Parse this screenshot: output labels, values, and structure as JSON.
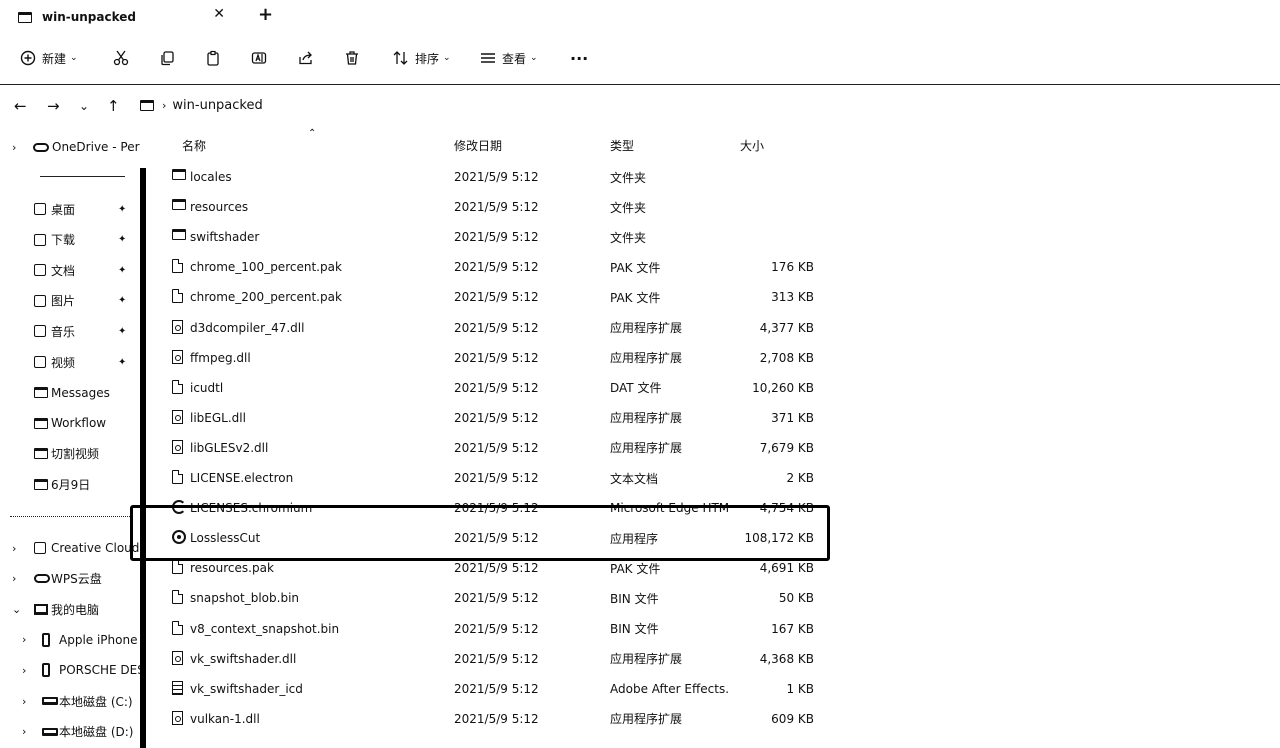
{
  "tab": {
    "title": "win-unpacked",
    "close": "✕",
    "new_tab": "+"
  },
  "toolbar": {
    "new_label": "新建",
    "new_chevron": "⌄",
    "sort_label": "排序",
    "view_label": "查看",
    "more": "···",
    "icons": [
      "plus-circle-icon",
      "cut-icon",
      "copy-icon",
      "paste-icon",
      "rename-icon",
      "share-icon",
      "delete-icon",
      "sort-icon",
      "view-icon"
    ]
  },
  "address": {
    "back": "←",
    "forward": "→",
    "recent": "⌄",
    "up": "↑",
    "separator": "›",
    "path": "win-unpacked"
  },
  "sidebar": {
    "onedrive": "OneDrive - Per",
    "quick_access": [
      {
        "label": "桌面",
        "pinned": true
      },
      {
        "label": "下载",
        "pinned": true
      },
      {
        "label": "文档",
        "pinned": true
      },
      {
        "label": "图片",
        "pinned": true
      },
      {
        "label": "音乐",
        "pinned": true
      },
      {
        "label": "视频",
        "pinned": true
      },
      {
        "label": "Messages",
        "pinned": false
      },
      {
        "label": "Workflow",
        "pinned": false
      },
      {
        "label": "切割视频",
        "pinned": false
      },
      {
        "label": "6月9日",
        "pinned": false
      }
    ],
    "locations": [
      {
        "label": "Creative Cloud",
        "expander": "›"
      },
      {
        "label": "WPS云盘",
        "expander": "›"
      },
      {
        "label": "我的电脑",
        "expander": "⌄"
      },
      {
        "label": "Apple iPhone",
        "expander": "›"
      },
      {
        "label": "PORSCHE DESIGN",
        "expander": "›"
      },
      {
        "label": "本地磁盘 (C:)",
        "expander": "›"
      },
      {
        "label": "本地磁盘 (D:)",
        "expander": "›"
      }
    ],
    "pin_glyph": "📌",
    "expander": "›"
  },
  "columns": {
    "name": "名称",
    "date": "修改日期",
    "type": "类型",
    "size": "大小",
    "sort_indicator": "⌃"
  },
  "files": [
    {
      "name": "locales",
      "date": "2021/5/9 5:12",
      "type": "文件夹",
      "size": "",
      "icon": "folder"
    },
    {
      "name": "resources",
      "date": "2021/5/9 5:12",
      "type": "文件夹",
      "size": "",
      "icon": "folder"
    },
    {
      "name": "swiftshader",
      "date": "2021/5/9 5:12",
      "type": "文件夹",
      "size": "",
      "icon": "folder"
    },
    {
      "name": "chrome_100_percent.pak",
      "date": "2021/5/9 5:12",
      "type": "PAK 文件",
      "size": "176 KB",
      "icon": "file"
    },
    {
      "name": "chrome_200_percent.pak",
      "date": "2021/5/9 5:12",
      "type": "PAK 文件",
      "size": "313 KB",
      "icon": "file"
    },
    {
      "name": "d3dcompiler_47.dll",
      "date": "2021/5/9 5:12",
      "type": "应用程序扩展",
      "size": "4,377 KB",
      "icon": "dll"
    },
    {
      "name": "ffmpeg.dll",
      "date": "2021/5/9 5:12",
      "type": "应用程序扩展",
      "size": "2,708 KB",
      "icon": "dll"
    },
    {
      "name": "icudtl",
      "date": "2021/5/9 5:12",
      "type": "DAT 文件",
      "size": "10,260 KB",
      "icon": "file"
    },
    {
      "name": "libEGL.dll",
      "date": "2021/5/9 5:12",
      "type": "应用程序扩展",
      "size": "371 KB",
      "icon": "dll"
    },
    {
      "name": "libGLESv2.dll",
      "date": "2021/5/9 5:12",
      "type": "应用程序扩展",
      "size": "7,679 KB",
      "icon": "dll"
    },
    {
      "name": "LICENSE.electron",
      "date": "2021/5/9 5:12",
      "type": "文本文档",
      "size": "2 KB",
      "icon": "file"
    },
    {
      "name": "LICENSES.chromium",
      "date": "2021/5/9 5:12",
      "type": "Microsoft Edge HTML",
      "size": "4,754 KB",
      "icon": "edge"
    },
    {
      "name": "LosslessCut",
      "date": "2021/5/9 5:12",
      "type": "应用程序",
      "size": "108,172 KB",
      "icon": "app"
    },
    {
      "name": "resources.pak",
      "date": "2021/5/9 5:12",
      "type": "PAK 文件",
      "size": "4,691 KB",
      "icon": "file"
    },
    {
      "name": "snapshot_blob.bin",
      "date": "2021/5/9 5:12",
      "type": "BIN 文件",
      "size": "50 KB",
      "icon": "file"
    },
    {
      "name": "v8_context_snapshot.bin",
      "date": "2021/5/9 5:12",
      "type": "BIN 文件",
      "size": "167 KB",
      "icon": "file"
    },
    {
      "name": "vk_swiftshader.dll",
      "date": "2021/5/9 5:12",
      "type": "应用程序扩展",
      "size": "4,368 KB",
      "icon": "dll"
    },
    {
      "name": "vk_swiftshader_icd",
      "date": "2021/5/9 5:12",
      "type": "Adobe After Effects...",
      "size": "1 KB",
      "icon": "txt"
    },
    {
      "name": "vulkan-1.dll",
      "date": "2021/5/9 5:12",
      "type": "应用程序扩展",
      "size": "609 KB",
      "icon": "dll"
    }
  ]
}
